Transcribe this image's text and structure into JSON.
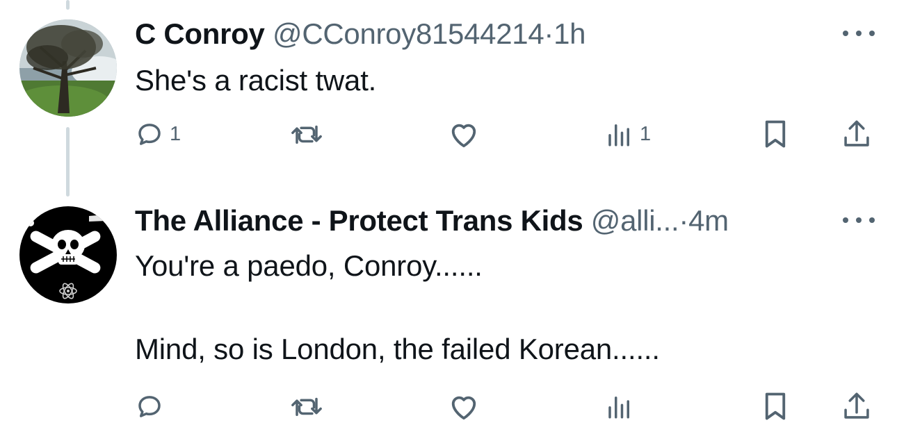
{
  "replies": [
    {
      "display_name": "C Conroy",
      "handle": "@CConroy81544214",
      "separator": "·",
      "time": "1h",
      "text": "She's a racist twat.",
      "reply_count": "1",
      "retweet_count": "",
      "like_count": "",
      "view_count": "1",
      "avatar_icon": "tree-landscape-avatar"
    },
    {
      "display_name": "The Alliance - Protect Trans Kids",
      "handle": "@alli...",
      "separator": "·",
      "time": "4m",
      "text": "You're a paedo, Conroy......\n\nMind, so is London, the failed Korean......",
      "reply_count": "",
      "retweet_count": "",
      "like_count": "",
      "view_count": "",
      "avatar_icon": "skull-crossbones-avatar"
    }
  ],
  "colors": {
    "text_primary": "#0f1419",
    "text_secondary": "#536471",
    "thread_line": "#cfd9de"
  }
}
